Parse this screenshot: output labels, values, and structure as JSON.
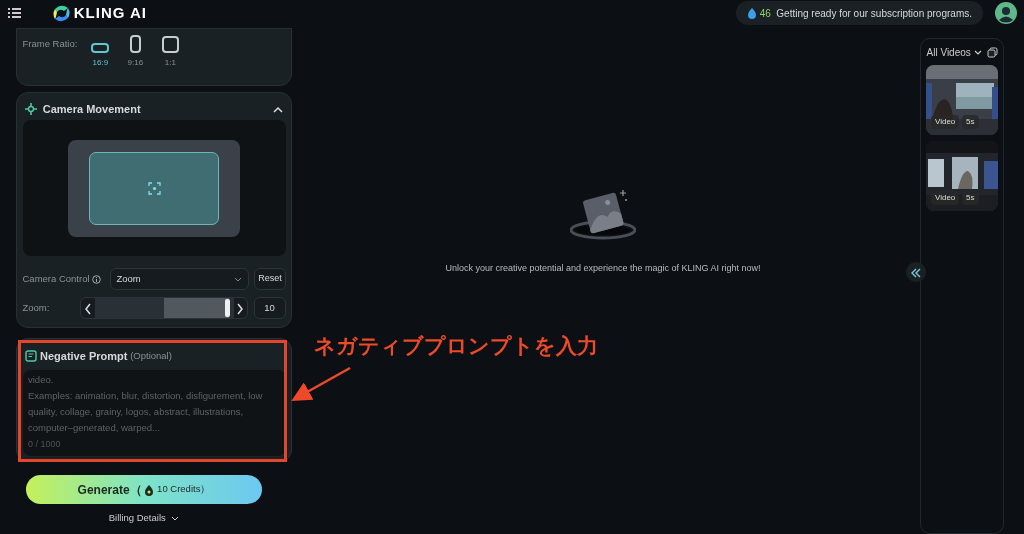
{
  "header": {
    "logo_text": "KLING AI",
    "credits": "46",
    "notice": "Getting ready for our subscription programs."
  },
  "frame_ratio": {
    "label": "Frame Ratio:",
    "options": [
      {
        "label": "16:9",
        "kind": "wide",
        "selected": true
      },
      {
        "label": "9:16",
        "kind": "tall",
        "selected": false
      },
      {
        "label": "1:1",
        "kind": "square",
        "selected": false
      }
    ]
  },
  "camera_movement": {
    "title": "Camera Movement",
    "expanded": true,
    "control_label": "Camera Control",
    "control_value": "Zoom",
    "reset": "Reset",
    "zoom_label": "Zoom:",
    "zoom": {
      "level": 0.97
    },
    "zoom_value": "10"
  },
  "negative_prompt": {
    "title": "Negative Prompt",
    "optional": "(Optional)",
    "placeholder": "video.\nExamples: animation, blur, distortion, disfigurement, low quality, collage, grainy, logos, abstract, illustrations, computer–generated, warped...",
    "counter": "0 / 1000"
  },
  "generate": {
    "label": "Generate（",
    "credits": "10 Credits）"
  },
  "billing": "Billing Details",
  "empty_state": {
    "message": "Unlock your creative potential and experience the magic of KLING AI right now!"
  },
  "gallery": {
    "title": "All Videos",
    "items": [
      {
        "type": "Video",
        "duration": "5s"
      },
      {
        "type": "Video",
        "duration": "5s"
      }
    ]
  },
  "annotation": {
    "text": "ネガティブプロンプトを入力"
  }
}
